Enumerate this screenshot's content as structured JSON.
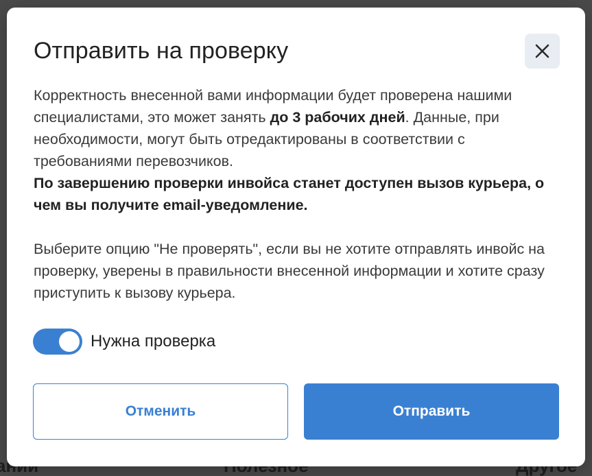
{
  "backdrop": {
    "text_1": "аний",
    "text_2": "Полезное",
    "text_3": "Другое"
  },
  "modal": {
    "title": "Отправить на проверку",
    "close_icon": "close-icon",
    "body": {
      "p1_part1": "Корректность внесенной вами информации будет проверена нашими специалистами, это может занять ",
      "p1_bold": "до 3 рабочих дней",
      "p1_part2": ". Данные, при необходимости, могут быть отредактированы в соответствии с требованиями перевозчиков.",
      "p1_bold_line": "По завершению проверки инвойса станет доступен вызов курьера, о чем вы получите email-уведомление.",
      "p2": "Выберите опцию \"Не проверять\", если вы не хотите отправлять инвойс на проверку, уверены в правильности внесенной информации и хотите сразу приступить к вызову курьера."
    },
    "toggle": {
      "label": "Нужна проверка",
      "checked": true
    },
    "buttons": {
      "cancel": "Отменить",
      "submit": "Отправить"
    }
  },
  "colors": {
    "accent": "#3a80d2",
    "close_bg": "#e8ecf3",
    "text": "#3a3a3a",
    "backdrop": "#4a4a4a"
  }
}
